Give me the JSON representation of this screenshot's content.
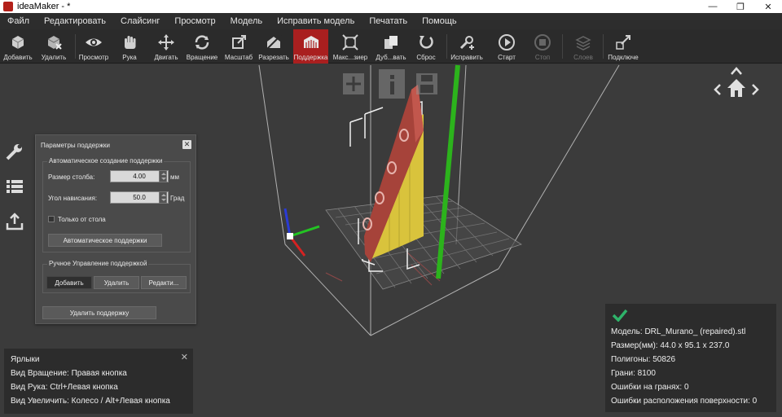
{
  "window": {
    "title": "ideaMaker - *",
    "minimize": "—",
    "restore": "❐",
    "close": "✕"
  },
  "menu": [
    "Файл",
    "Редактировать",
    "Слайсинг",
    "Просмотр",
    "Модель",
    "Исправить модель",
    "Печатать",
    "Помощь"
  ],
  "toolbar": {
    "add": "Добавить",
    "remove": "Удалить",
    "view": "Просмотр",
    "hand": "Рука",
    "move": "Двигать",
    "rotate": "Вращение",
    "scale": "Масштаб",
    "cut": "Разрезать",
    "support": "Поддержка",
    "maximize": "Макс...зиер",
    "duplicate": "Дуб...вать",
    "reset": "Сброс",
    "repair": "Исправить",
    "start": "Старт",
    "stop": "Стоп",
    "layers": "Слоев",
    "connect": "Подключе"
  },
  "support_panel": {
    "title": "Параметры поддержки",
    "close": "✕",
    "auto_group": "Автоматическое создание поддержки",
    "column_size_label": "Размер столба:",
    "column_size_value": "4.00",
    "column_size_unit": "мм",
    "overhang_label": "Угол нависания:",
    "overhang_value": "50.0",
    "overhang_unit": "Град",
    "only_from_bed": "Только от стола",
    "auto_button": "Автоматическое поддержки",
    "manual_group": "Ручное Управление поддержкой",
    "add_button": "Добавить",
    "remove_button": "Удалить",
    "edit_button": "Редакти...",
    "delete_support": "Удалить поддержку"
  },
  "shortcuts": {
    "title": "Ярлыки",
    "close": "✕",
    "rotate": "Вид Вращение: Правая кнопка",
    "hand": "Вид Рука: Ctrl+Левая кнопка",
    "zoom": "Вид Увеличить: Колесо / Alt+Левая кнопка"
  },
  "model_info": {
    "model": "Модель: DRL_Murano_ (repaired).stl",
    "size": "Размер(мм): 44.0 x 95.1 x 237.0",
    "polygons": "Полигоны: 50826",
    "edges": "Грани: 8100",
    "edge_errors": "Ошибки на гранях: 0",
    "surface_errors": "Ошибки расположения поверхности: 0"
  },
  "colors": {
    "accent": "#a91f1f",
    "support": "#e0c93a",
    "model": "#a8453c",
    "ok": "#2fb36a",
    "green_bar": "#2cb31c"
  }
}
